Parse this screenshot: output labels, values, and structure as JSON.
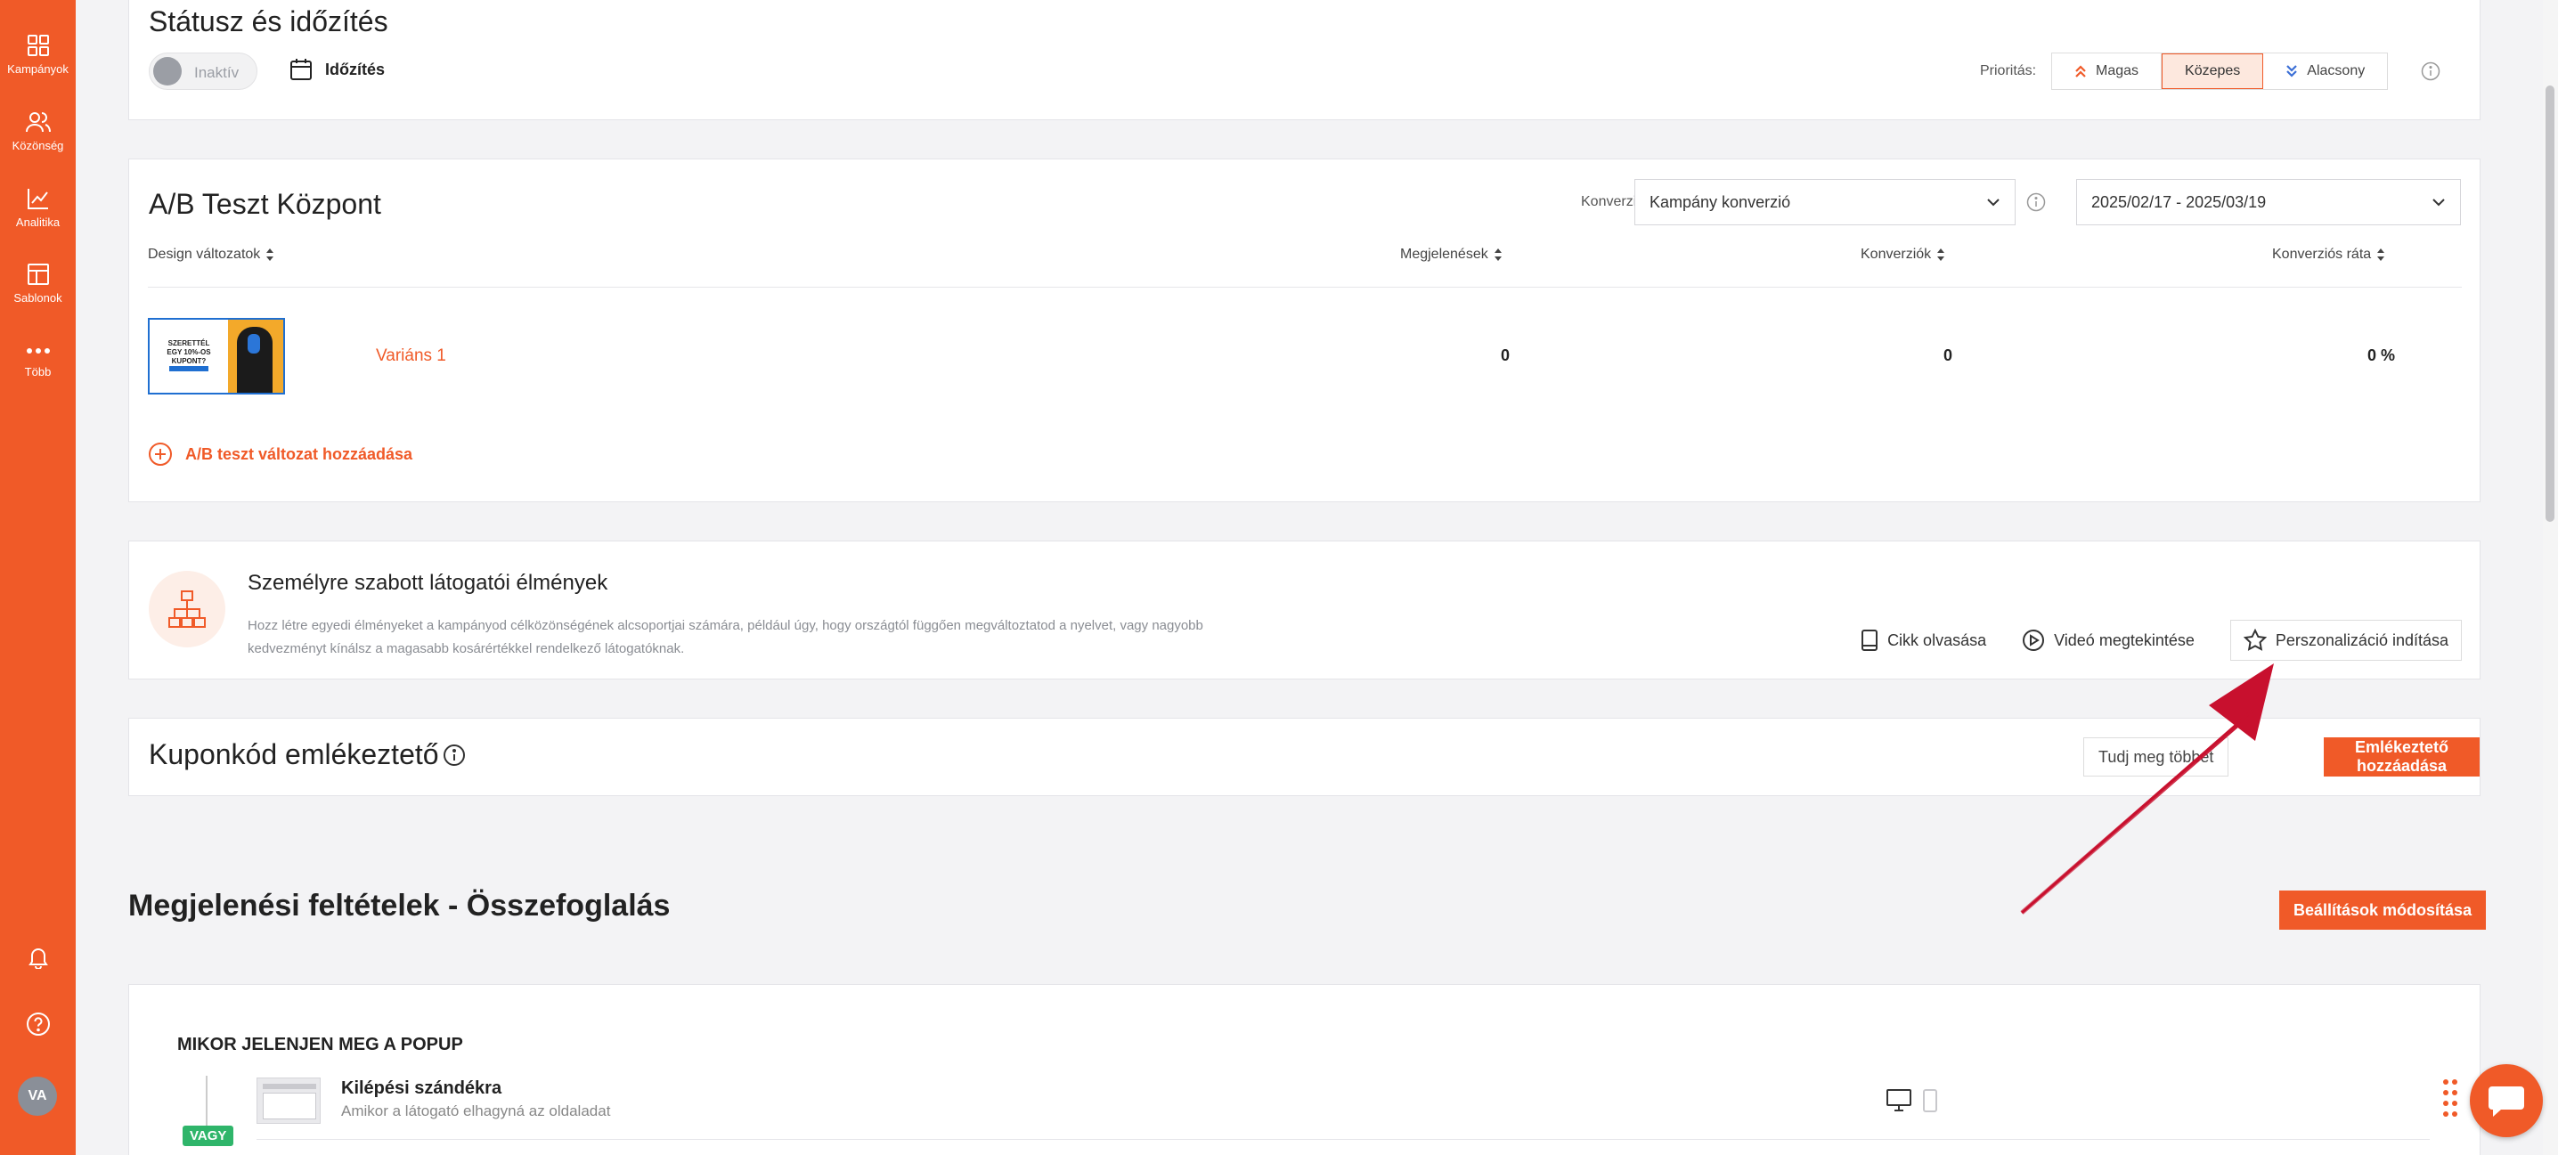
{
  "sidebar": {
    "items": [
      {
        "label": "Kampányok",
        "icon": "grid-icon"
      },
      {
        "label": "Közönség",
        "icon": "users-icon"
      },
      {
        "label": "Analitika",
        "icon": "chart-line-icon"
      },
      {
        "label": "Sablonok",
        "icon": "layout-icon"
      },
      {
        "label": "Több",
        "icon": "more-dots-icon"
      }
    ],
    "avatar_initials": "VA"
  },
  "status": {
    "title": "Státusz és időzítés",
    "toggle_label": "Inaktív",
    "schedule_label": "Időzítés",
    "priority_label": "Prioritás:",
    "priority_options": [
      "Magas",
      "Közepes",
      "Alacsony"
    ],
    "priority_selected": "Közepes"
  },
  "ab_test": {
    "title": "A/B Teszt Központ",
    "conversion_label": "Konverzió",
    "conversion_select": "Kampány konverzió",
    "date_range": "2025/02/17 - 2025/03/19",
    "columns": [
      "Design változatok",
      "Megjelenések",
      "Konverziók",
      "Konverziós ráta"
    ],
    "rows": [
      {
        "variant": "Variáns 1",
        "impressions": "0",
        "conversions": "0",
        "rate": "0 %",
        "thumb_text_line1": "SZERETTÉL",
        "thumb_text_line2": "EGY 10%-OS KUPONT?"
      }
    ],
    "add_variant_label": "A/B teszt változat hozzáadása"
  },
  "personalization": {
    "title": "Személyre szabott látogatói élmények",
    "description_line1": "Hozz létre egyedi élményeket a kampányod célközönségének alcsoportjai számára, például úgy, hogy országtól függően megváltoztatod a nyelvet, vagy nagyobb",
    "description_line2": "kedvezményt kínálsz a magasabb kosárértékkel rendelkező látogatóknak.",
    "read_article": "Cikk olvasása",
    "watch_video": "Videó megtekintése",
    "start_button": "Perszonalizáció indítása"
  },
  "coupon": {
    "title": "Kuponkód emlékeztető",
    "more_button": "Tudj meg többet",
    "add_button": "Emlékeztető hozzáadása"
  },
  "conditions": {
    "title": "Megjelenési feltételek - Összefoglalás",
    "modify_button": "Beállítások módosítása",
    "when_heading": "MIKOR JELENJEN MEG A POPUP",
    "exit_title": "Kilépési szándékra",
    "exit_subtitle": "Amikor a látogató elhagyná az oldaladat",
    "or_badge": "VAGY"
  },
  "colors": {
    "accent": "#f05a28",
    "badge_green": "#2fb56a",
    "annotation_arrow": "#c8102e"
  }
}
